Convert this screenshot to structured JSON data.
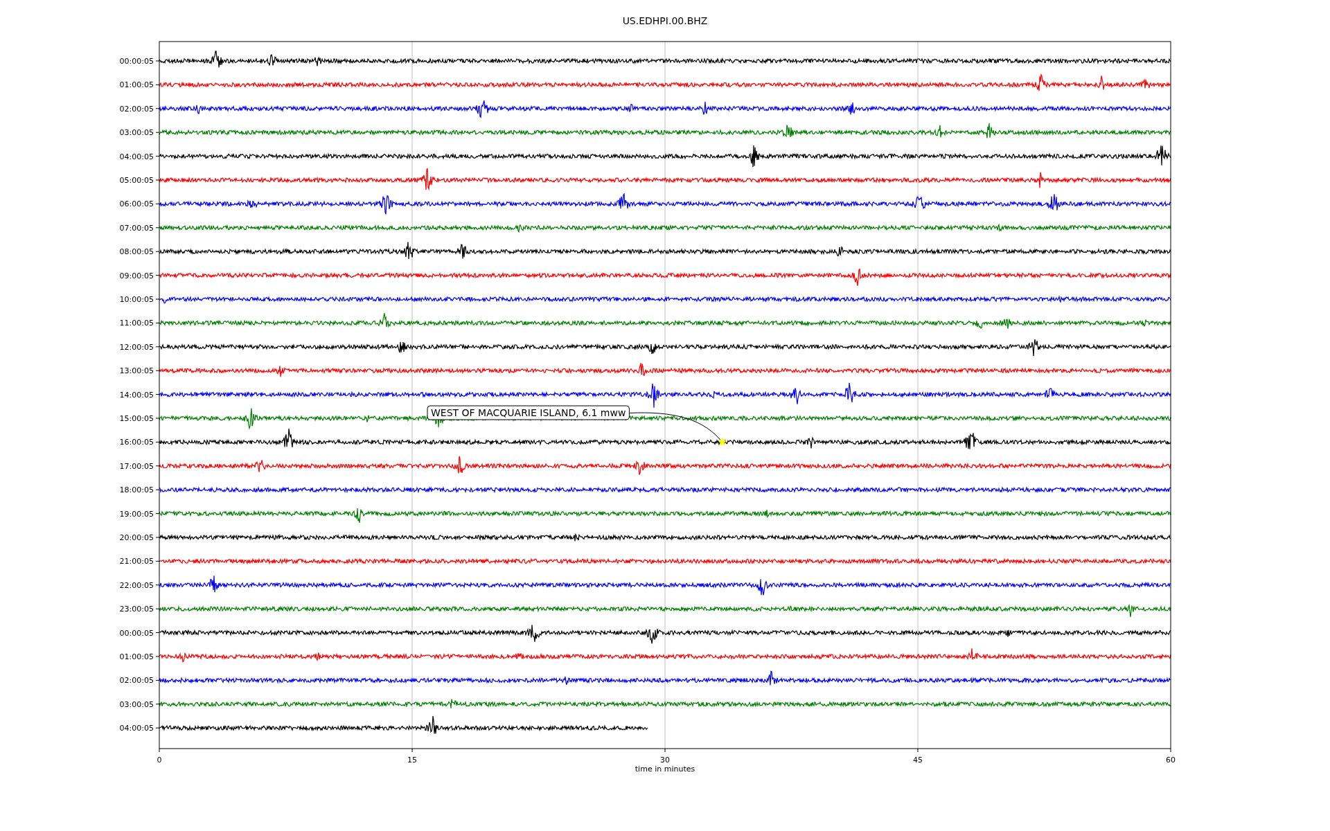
{
  "title": "US.EDHPI.00.BHZ",
  "rows": [
    {
      "label": "00:00:05",
      "color": "#000000",
      "level": 1
    },
    {
      "label": "01:00:05",
      "color": "#ff0000",
      "level": 1
    },
    {
      "label": "02:00:05",
      "color": "#0000ff",
      "level": 1
    },
    {
      "label": "03:00:05",
      "color": "#008000",
      "level": 1
    },
    {
      "label": "04:00:05",
      "color": "#000000",
      "level": 1
    },
    {
      "label": "05:00:05",
      "color": "#ff0000",
      "level": 1
    },
    {
      "label": "06:00:05",
      "color": "#0000ff",
      "level": 1
    },
    {
      "label": "07:00:05",
      "color": "#008000",
      "level": 1
    },
    {
      "label": "08:00:05",
      "color": "#000000",
      "level": 1
    },
    {
      "label": "09:00:05",
      "color": "#ff0000",
      "level": 1
    },
    {
      "label": "10:00:05",
      "color": "#0000ff",
      "level": 1
    },
    {
      "label": "11:00:05",
      "color": "#008000",
      "level": 1
    },
    {
      "label": "12:00:05",
      "color": "#000000",
      "level": 1
    },
    {
      "label": "13:00:05",
      "color": "#ff0000",
      "level": 1
    },
    {
      "label": "14:00:05",
      "color": "#0000ff",
      "level": 1
    },
    {
      "label": "15:00:05",
      "color": "#008000",
      "level": 1
    },
    {
      "label": "16:00:05",
      "color": "#000000",
      "level": 1
    },
    {
      "label": "17:00:05",
      "color": "#ff0000",
      "level": 1
    },
    {
      "label": "18:00:05",
      "color": "#0000ff",
      "level": 1
    },
    {
      "label": "19:00:05",
      "color": "#008000",
      "level": 1
    },
    {
      "label": "20:00:05",
      "color": "#000000",
      "level": 1
    },
    {
      "label": "21:00:05",
      "color": "#ff0000",
      "level": 1
    },
    {
      "label": "22:00:05",
      "color": "#0000ff",
      "level": 1
    },
    {
      "label": "23:00:05",
      "color": "#008000",
      "level": 1
    },
    {
      "label": "00:00:05",
      "color": "#000000",
      "level": 1
    },
    {
      "label": "01:00:05",
      "color": "#ff0000",
      "level": 1
    },
    {
      "label": "02:00:05",
      "color": "#0000ff",
      "level": 1
    },
    {
      "label": "03:00:05",
      "color": "#008000",
      "level": 1
    },
    {
      "label": "04:00:05",
      "color": "#000000",
      "level": 0.483
    }
  ],
  "x_axis": {
    "ticks": [
      "0",
      "15",
      "30",
      "45",
      "60"
    ],
    "label": "time in minutes"
  },
  "annotation": {
    "text": "WEST OF MACQUARIE ISLAND, 6.1 mww"
  }
}
